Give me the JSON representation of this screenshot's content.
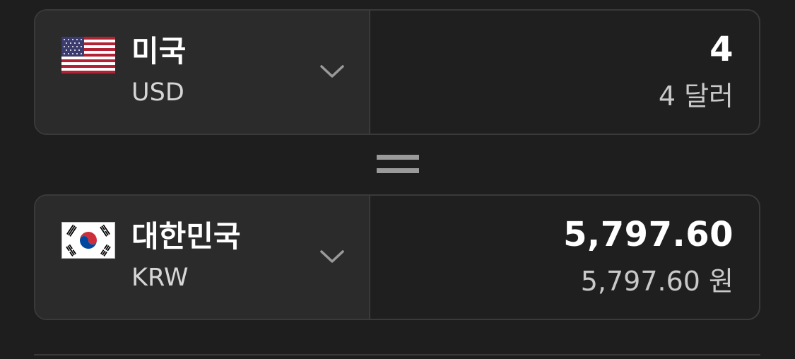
{
  "from": {
    "country": "미국",
    "code": "USD",
    "flag_icon": "us-flag-icon",
    "amount": "4",
    "amount_words": "4 달러"
  },
  "to": {
    "country": "대한민국",
    "code": "KRW",
    "flag_icon": "kr-flag-icon",
    "amount": "5,797.60",
    "amount_words": "5,797.60 원"
  },
  "colors": {
    "background": "#1e1e1e",
    "selector_bg": "#2b2b2b",
    "border": "#3a3a3a",
    "primary_text": "#ffffff",
    "secondary_text": "#c9c9c9"
  }
}
